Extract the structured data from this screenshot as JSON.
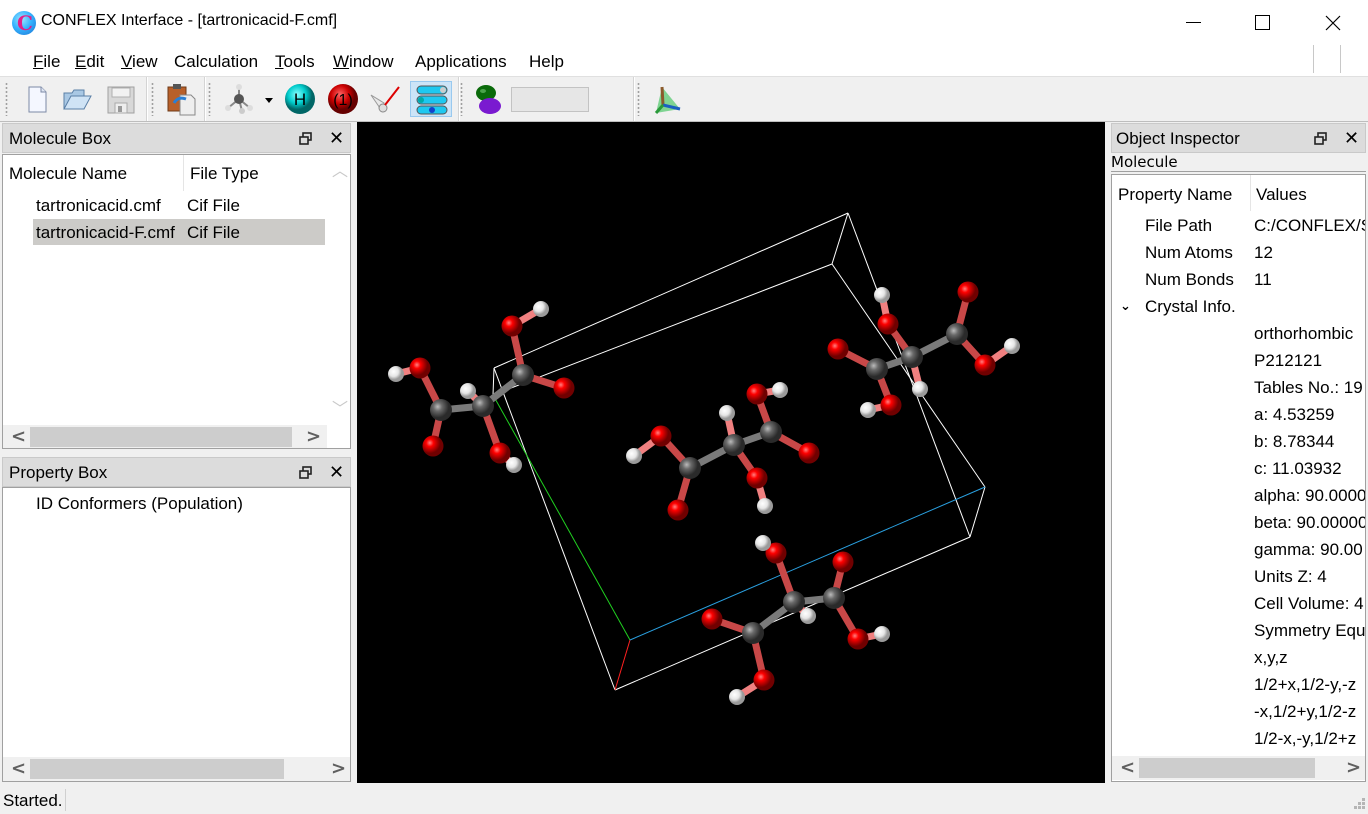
{
  "window": {
    "title": "CONFLEX Interface - [tartronicacid-F.cmf]",
    "app_icon": "conflex-logo-icon",
    "controls": [
      "minimize-icon",
      "maximize-icon",
      "close-icon"
    ]
  },
  "menubar": {
    "items": [
      {
        "label": "File",
        "accel": "F"
      },
      {
        "label": "Edit",
        "accel": "E"
      },
      {
        "label": "View",
        "accel": "V"
      },
      {
        "label": "Calculation",
        "accel": ""
      },
      {
        "label": "Tools",
        "accel": "T"
      },
      {
        "label": "Window",
        "accel": "W"
      },
      {
        "label": "Applications",
        "accel": ""
      },
      {
        "label": "Help",
        "accel": ""
      }
    ]
  },
  "toolbar": {
    "buttons": [
      {
        "name": "new-file",
        "icon": "new-file-icon"
      },
      {
        "name": "open-file",
        "icon": "open-folder-icon"
      },
      {
        "name": "save-file",
        "icon": "save-disk-icon",
        "enabled": false
      },
      {
        "name": "paste-import",
        "icon": "clipboard-paste-icon"
      },
      {
        "name": "molecule-model",
        "icon": "molecule-model-icon",
        "has_dropdown": true
      },
      {
        "name": "add-hydrogen",
        "icon": "hydrogen-atom-icon",
        "glyph": "H"
      },
      {
        "name": "atom-number",
        "icon": "atom-number-icon",
        "glyph": "(1)"
      },
      {
        "name": "measure",
        "icon": "measure-tool-icon"
      },
      {
        "name": "display-settings",
        "icon": "slider-settings-icon",
        "active": true
      },
      {
        "name": "orbital",
        "icon": "orbital-icon"
      },
      {
        "name": "crystal-cell",
        "icon": "crystal-cell-icon"
      }
    ],
    "field_value": ""
  },
  "molecule_box": {
    "title": "Molecule Box",
    "columns": [
      "Molecule Name",
      "File Type"
    ],
    "rows": [
      {
        "name": "tartronicacid.cmf",
        "type": "Cif File",
        "selected": false
      },
      {
        "name": "tartronicacid-F.cmf",
        "type": "Cif File",
        "selected": true
      }
    ]
  },
  "property_box": {
    "title": "Property Box",
    "columns": [
      "ID Conformers (Population)"
    ]
  },
  "object_inspector": {
    "title": "Object Inspector",
    "subtitle": "Molecule",
    "columns": [
      "Property Name",
      "Values"
    ],
    "properties": [
      {
        "name": "File Path",
        "value": "C:/CONFLEX/S"
      },
      {
        "name": "Num Atoms",
        "value": "12"
      },
      {
        "name": "Num Bonds",
        "value": "11"
      },
      {
        "name": "Crystal Info.",
        "value": "",
        "expanded": true
      }
    ],
    "crystal_values": [
      "orthorhombic",
      "P212121",
      "Tables No.: 19",
      "a: 4.53259",
      "b: 8.78344",
      "c: 11.03932",
      "alpha: 90.0000",
      "beta: 90.00000",
      "gamma: 90.00",
      "Units Z: 4",
      "Cell Volume: 4",
      "Symmetry Equ",
      "x,y,z",
      "1/2+x,1/2-y,-z",
      "-x,1/2+y,1/2-z",
      "1/2-x,-y,1/2+z"
    ]
  },
  "viewer": {
    "background": "#000000",
    "colors": {
      "carbon": "#6e6e6e",
      "oxygen": "#e00000",
      "hydrogen": "#e8e8e8",
      "cell": "#ffffff",
      "axis_a": "#ff2020",
      "axis_b": "#20d020",
      "axis_c": "#2aa0e0"
    }
  },
  "status": {
    "text": "Started."
  }
}
